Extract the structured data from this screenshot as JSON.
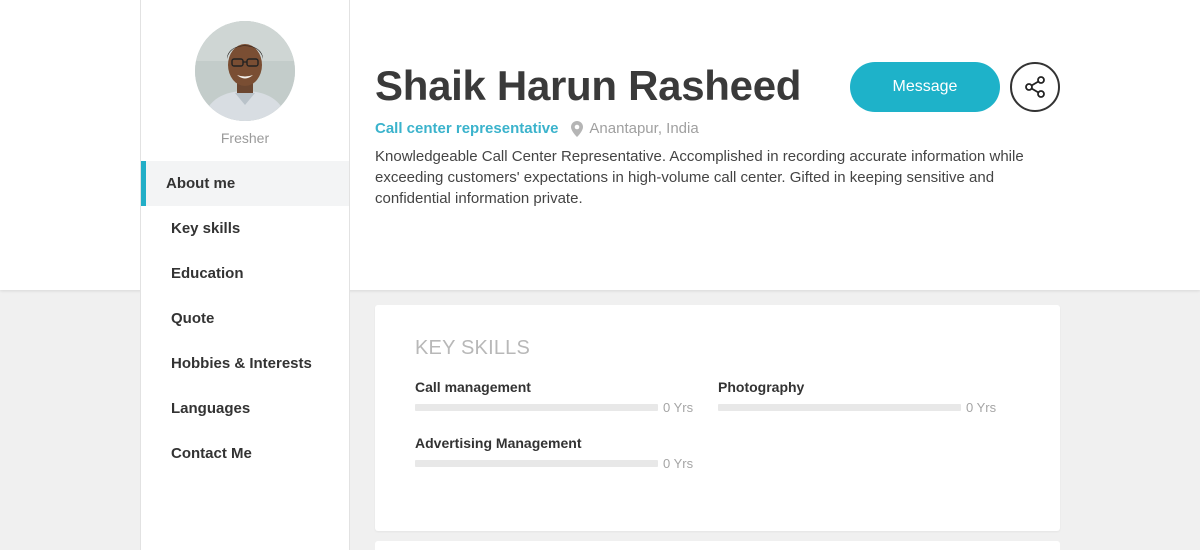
{
  "sidebar": {
    "status": "Fresher",
    "nav": [
      {
        "label": "About me",
        "active": true
      },
      {
        "label": "Key skills"
      },
      {
        "label": "Education"
      },
      {
        "label": "Quote"
      },
      {
        "label": "Hobbies & Interests"
      },
      {
        "label": "Languages"
      },
      {
        "label": "Contact Me"
      }
    ]
  },
  "profile": {
    "name": "Shaik Harun Rasheed",
    "job_title": "Call center representative",
    "location": "Anantapur, India",
    "summary": "Knowledgeable Call Center Representative. Accomplished in recording accurate information while exceeding customers' expectations in high-volume call center. Gifted in keeping sensitive and confidential information private."
  },
  "actions": {
    "message_label": "Message",
    "share_icon": "share-icon"
  },
  "key_skills": {
    "title": "KEY SKILLS",
    "skills": [
      {
        "name": "Call management",
        "years": "0 Yrs",
        "level": 0
      },
      {
        "name": "Photography",
        "years": "0 Yrs",
        "level": 0
      },
      {
        "name": "Advertising Management",
        "years": "0 Yrs",
        "level": 0
      }
    ]
  },
  "colors": {
    "accent": "#1eb2c9",
    "job_title": "#3bb3cc",
    "background": "#f0f0f0"
  }
}
